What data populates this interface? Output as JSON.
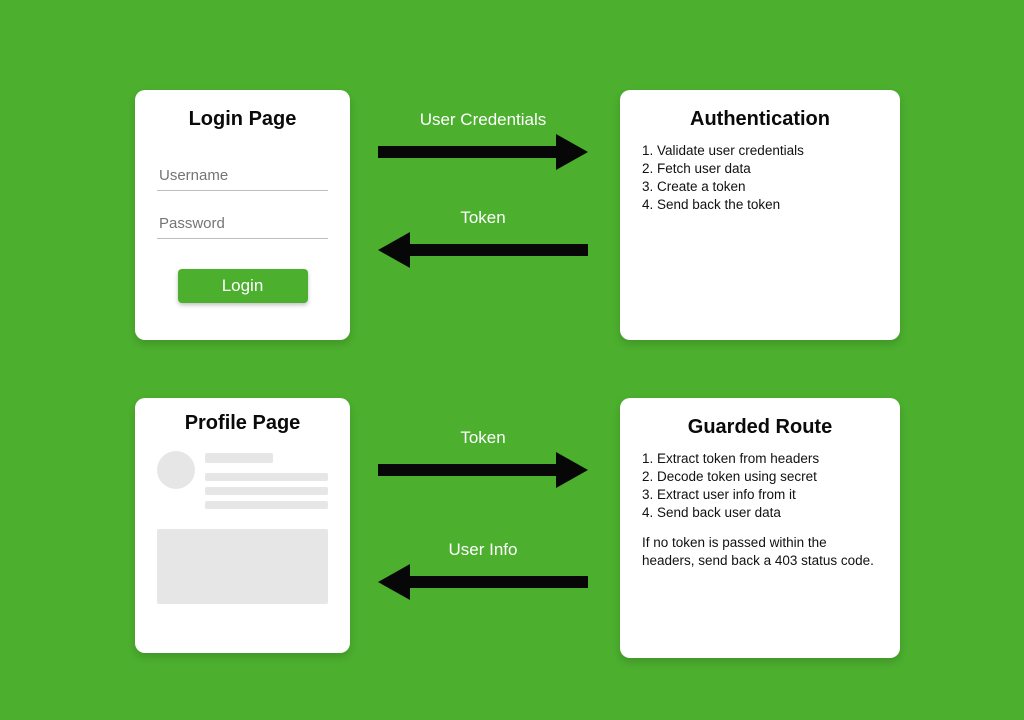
{
  "login": {
    "title": "Login Page",
    "username_placeholder": "Username",
    "password_placeholder": "Password",
    "button_label": "Login"
  },
  "auth": {
    "title": "Authentication",
    "steps": {
      "s1": "1. Validate user credentials",
      "s2": "2. Fetch user data",
      "s3": "3. Create a token",
      "s4": "4. Send back the token"
    }
  },
  "profile": {
    "title": "Profile Page"
  },
  "guard": {
    "title": "Guarded Route",
    "steps": {
      "s1": "1. Extract token from headers",
      "s2": "2. Decode token using secret",
      "s3": "3. Extract user info from it",
      "s4": "4. Send back user data"
    },
    "note": "If no token is passed within the headers, send back a 403 status code."
  },
  "arrows": {
    "user_credentials": "User Credentials",
    "token1": "Token",
    "token2": "Token",
    "user_info": "User Info"
  }
}
